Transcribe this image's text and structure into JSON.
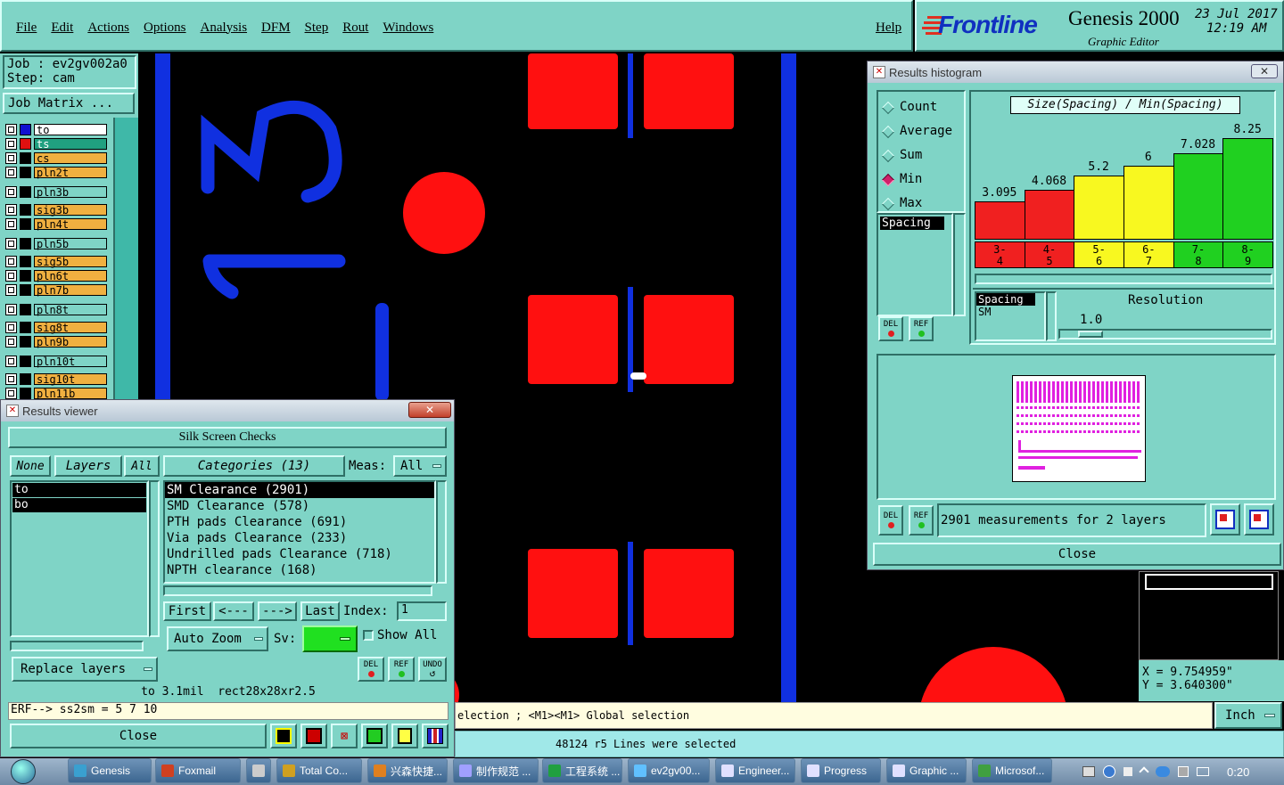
{
  "menu": {
    "items": [
      "File",
      "Edit",
      "Actions",
      "Options",
      "Analysis",
      "DFM",
      "Step",
      "Rout",
      "Windows"
    ],
    "help": "Help"
  },
  "brand": {
    "logo": "Frontline",
    "product": "Genesis 2000",
    "subtitle": "Graphic Editor",
    "date": "23 Jul 2017",
    "time": "12:19 AM"
  },
  "job": {
    "job_label": "Job : ev2gv002a0",
    "step_label": "Step: cam",
    "matrix_button": "Job Matrix ..."
  },
  "layers": [
    {
      "name": "to",
      "color": "#ffffff",
      "swatch": "#1010d0"
    },
    {
      "name": "ts",
      "color": "#20a080",
      "swatch": "#e01010"
    },
    {
      "name": "cs",
      "color": "#f0b040",
      "swatch": ""
    },
    {
      "name": "pln2t",
      "color": "#f0b040",
      "swatch": ""
    },
    {
      "name": "pln3b",
      "color": "#7fd4c6",
      "swatch": ""
    },
    {
      "name": "sig3b",
      "color": "#f0b040",
      "swatch": ""
    },
    {
      "name": "pln4t",
      "color": "#f0b040",
      "swatch": ""
    },
    {
      "name": "pln5b",
      "color": "#7fd4c6",
      "swatch": ""
    },
    {
      "name": "sig5b",
      "color": "#f0b040",
      "swatch": ""
    },
    {
      "name": "pln6t",
      "color": "#f0b040",
      "swatch": ""
    },
    {
      "name": "pln7b",
      "color": "#f0b040",
      "swatch": ""
    },
    {
      "name": "pln8t",
      "color": "#7fd4c6",
      "swatch": ""
    },
    {
      "name": "sig8t",
      "color": "#f0b040",
      "swatch": ""
    },
    {
      "name": "pln9b",
      "color": "#f0b040",
      "swatch": ""
    },
    {
      "name": "pln10t",
      "color": "#7fd4c6",
      "swatch": ""
    },
    {
      "name": "sig10t",
      "color": "#f0b040",
      "swatch": ""
    },
    {
      "name": "pln11b",
      "color": "#f0b040",
      "swatch": ""
    }
  ],
  "canvas": {
    "silk_text": "13"
  },
  "results_viewer": {
    "title": "Results viewer",
    "close_x": "✕",
    "heading": "Silk Screen Checks",
    "none": "None",
    "layers_btn": "Layers",
    "all": "All",
    "categories_btn": "Categories (13)",
    "meas_label": "Meas:",
    "meas_value": "All",
    "layer_list": [
      "to",
      "bo"
    ],
    "categories": [
      "SM Clearance (2901)",
      "SMD Clearance (578)",
      "PTH pads Clearance (691)",
      "Via pads Clearance (233)",
      "Undrilled pads Clearance (718)",
      "NPTH clearance (168)"
    ],
    "first": "First",
    "prev": "<---",
    "next": "--->",
    "last": "Last",
    "index_label": "Index:",
    "index_value": "1",
    "auto_zoom": "Auto Zoom",
    "sv_label": "Sv:",
    "show_all": "Show All",
    "del": "DEL",
    "ref": "REF",
    "undo": "UNDO",
    "replace": "Replace layers",
    "info": "to 3.1mil  rect28x28xr2.5",
    "erf": "ERF--> ss2sm = 5 7 10",
    "close": "Close"
  },
  "histogram": {
    "title": "Results histogram",
    "close_x": "✕",
    "modes": [
      "Count",
      "Average",
      "Sum",
      "Min",
      "Max"
    ],
    "selected_mode": "Min",
    "attr_list_label": "Spacing",
    "chart_title": "Size(Spacing) / Min(Spacing)",
    "del": "DEL",
    "ref": "REF",
    "spacing_label": "Spacing",
    "sm_label": "SM",
    "resolution_label": "Resolution",
    "resolution_value": "1.0",
    "summary": "2901 measurements for 2 layers",
    "close": "Close"
  },
  "chart_data": {
    "type": "bar",
    "title": "Size(Spacing) / Min(Spacing)",
    "categories": [
      "3-4",
      "4-5",
      "5-6",
      "6-7",
      "7-8",
      "8-9"
    ],
    "category_top": [
      "3-",
      "4-",
      "5-",
      "6-",
      "7-",
      "8-"
    ],
    "category_bottom": [
      "4",
      "5",
      "6",
      "7",
      "8",
      "9"
    ],
    "values": [
      3.095,
      4.068,
      5.2,
      6,
      7.028,
      8.25
    ],
    "value_labels": [
      "3.095",
      "4.068",
      "5.2",
      "6",
      "7.028",
      "8.25"
    ],
    "bar_colors": [
      "#f02020",
      "#f02020",
      "#f8f820",
      "#f8f820",
      "#20d020",
      "#20d020"
    ],
    "ylim": [
      0,
      8.25
    ]
  },
  "coords": {
    "x": "X = 9.754959\"",
    "y": "Y = 3.640300\""
  },
  "status": {
    "line1": "election ; <M1><M1> Global selection",
    "unit": "Inch",
    "line2": "48124 r5 Lines were selected"
  },
  "taskbar": {
    "items": [
      "Genesis",
      "Foxmail",
      "",
      "Total Co...",
      "兴森快捷...",
      "制作规范 ...",
      "工程系统 ...",
      "ev2gv00...",
      "Engineer...",
      "Progress",
      "Graphic ...",
      "Microsof..."
    ],
    "clock": "0:20"
  }
}
